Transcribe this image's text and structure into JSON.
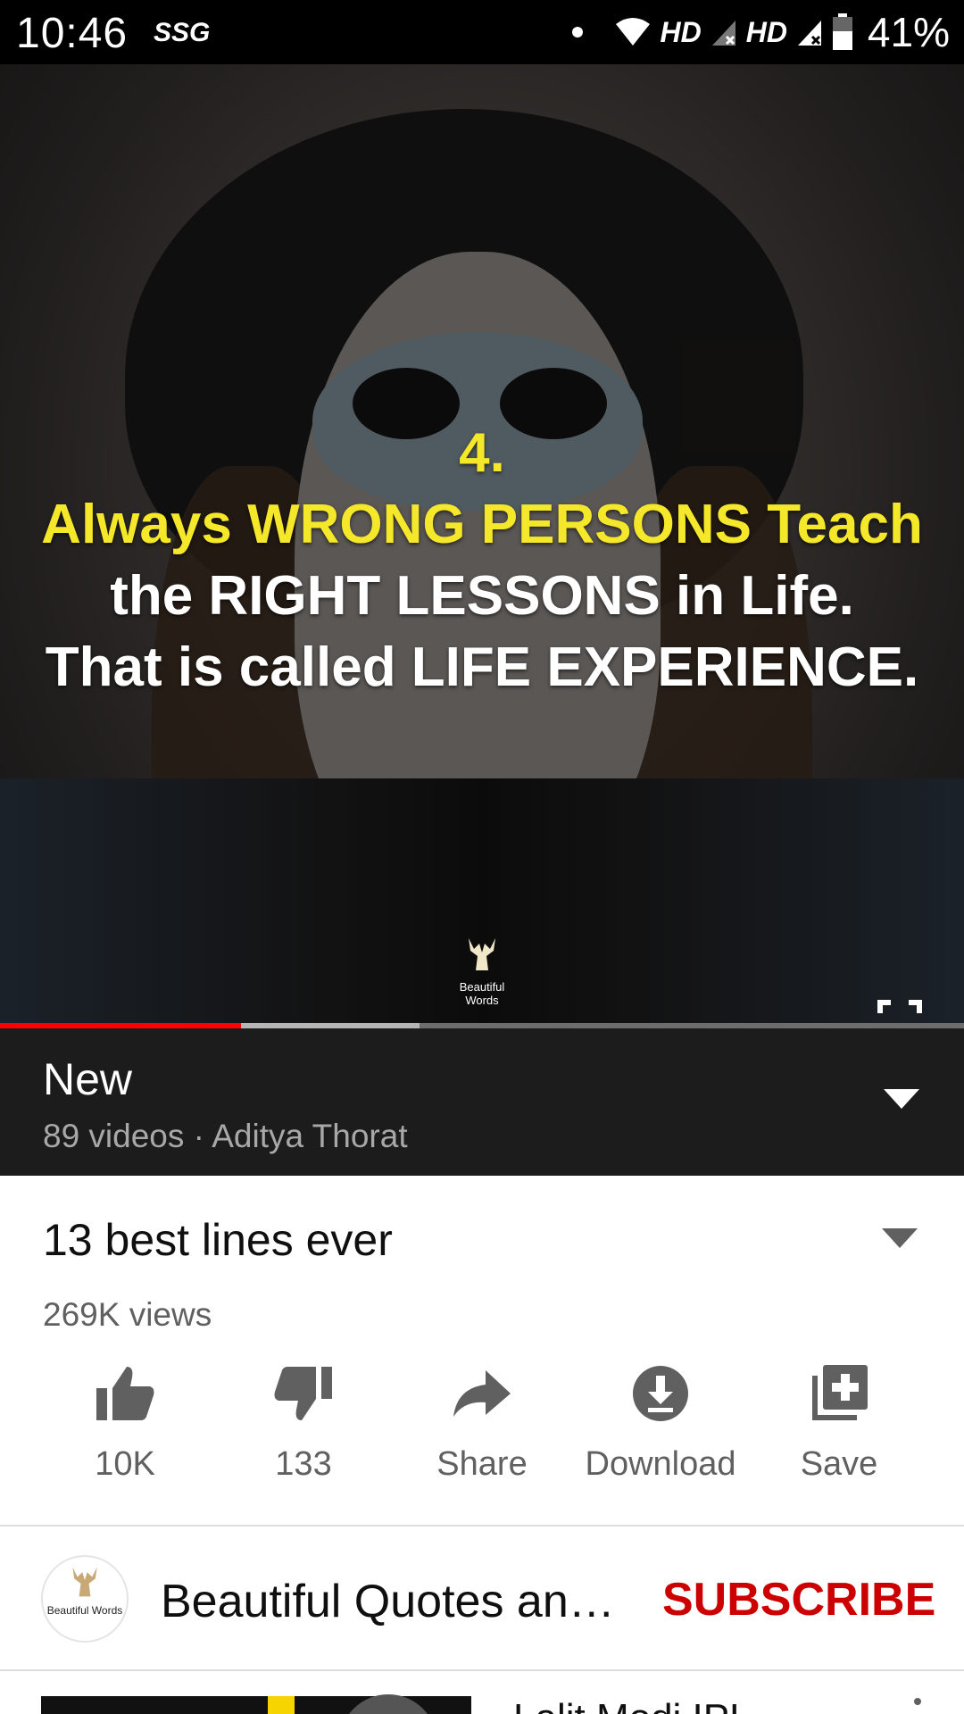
{
  "status_bar": {
    "time": "10:46",
    "carrier": "SSG",
    "network_1": "HD",
    "network_2": "HD",
    "battery_percent": "41%"
  },
  "player": {
    "overlay_lines": [
      "4.",
      "Always WRONG PERSONS Teach",
      "the RIGHT LESSONS in Life.",
      "That is called LIFE EXPERIENCE."
    ],
    "watermark": "Beautiful Words",
    "progress_played": 0.25,
    "progress_buffered": 0.435,
    "accent_color": "#ff0000"
  },
  "playlist": {
    "title": "New",
    "meta": "89 videos · Aditya Thorat"
  },
  "video": {
    "title": "13 best lines ever",
    "views": "269K views"
  },
  "actions": [
    {
      "icon": "thumb-up-icon",
      "label": "10K"
    },
    {
      "icon": "thumb-down-icon",
      "label": "133"
    },
    {
      "icon": "share-icon",
      "label": "Share"
    },
    {
      "icon": "download-icon",
      "label": "Download"
    },
    {
      "icon": "add-to-playlist-icon",
      "label": "Save"
    }
  ],
  "channel": {
    "name": "Beautiful Quotes an…",
    "avatar_text": "Beautiful Words",
    "subscribe_label": "SUBSCRIBE",
    "subscribe_color": "#cc0000"
  },
  "up_next": {
    "title": "Lalit Modi IPL"
  }
}
